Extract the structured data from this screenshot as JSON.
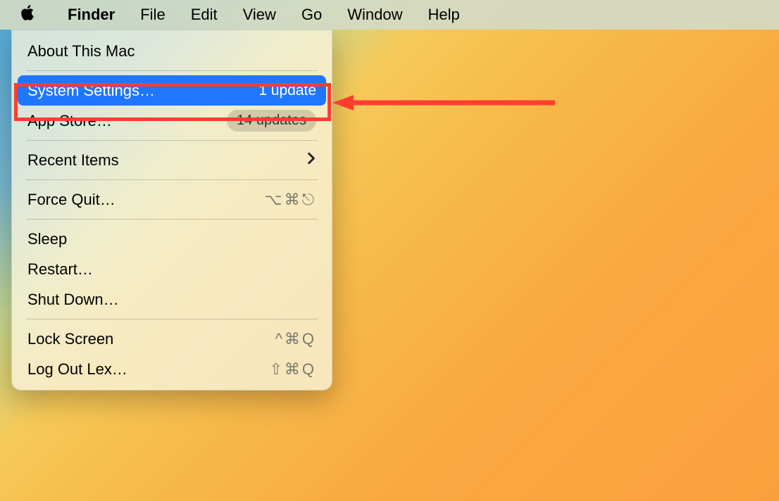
{
  "menubar": {
    "app_name": "Finder",
    "items": [
      "File",
      "Edit",
      "View",
      "Go",
      "Window",
      "Help"
    ]
  },
  "apple_menu": {
    "about": "About This Mac",
    "system_settings": {
      "label": "System Settings…",
      "badge": "1 update"
    },
    "app_store": {
      "label": "App Store…",
      "badge": "14 updates"
    },
    "recent_items": "Recent Items",
    "force_quit": {
      "label": "Force Quit…",
      "shortcut": "⌥⌘⎋"
    },
    "sleep": "Sleep",
    "restart": "Restart…",
    "shut_down": "Shut Down…",
    "lock_screen": {
      "label": "Lock Screen",
      "shortcut": "^⌘Q"
    },
    "log_out": {
      "label": "Log Out Lex…",
      "shortcut": "⇧⌘Q"
    }
  },
  "annotation": {
    "highlight_color": "#ff3d2e"
  }
}
